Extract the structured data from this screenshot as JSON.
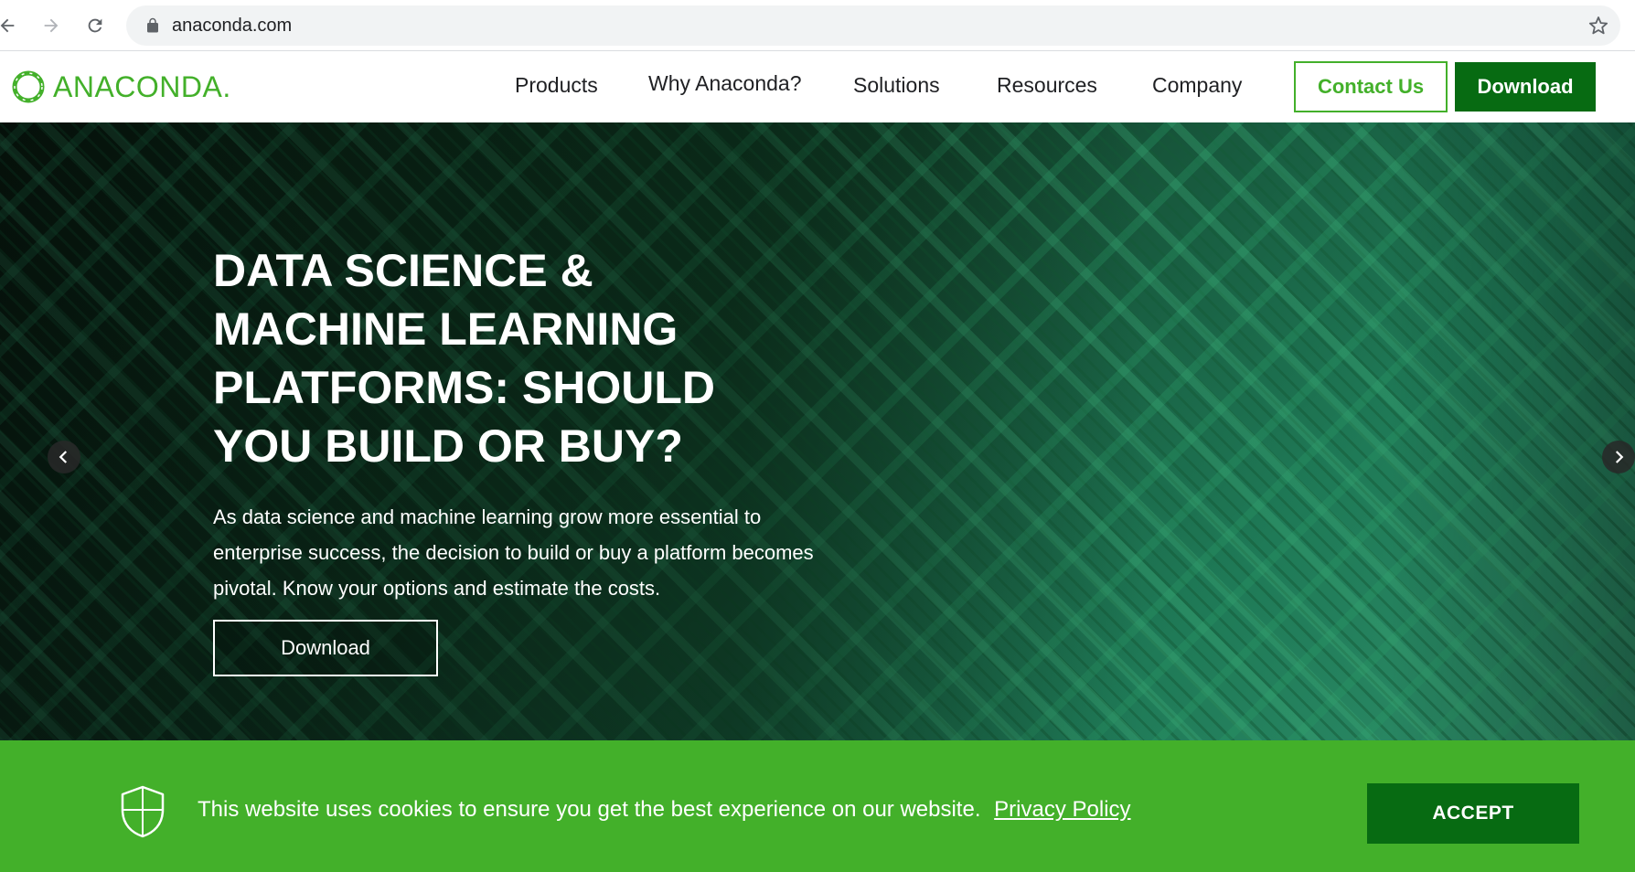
{
  "browser": {
    "url": "anaconda.com",
    "back_icon": "arrow-left-icon",
    "forward_icon": "arrow-right-icon",
    "reload_icon": "reload-icon",
    "lock_icon": "lock-icon",
    "bookmark_icon": "star-icon"
  },
  "header": {
    "logo_text": "ANACONDA.",
    "nav": [
      {
        "label": "Products"
      },
      {
        "label": "Why Anaconda?"
      },
      {
        "label": "Solutions"
      },
      {
        "label": "Resources"
      },
      {
        "label": "Company"
      }
    ],
    "contact_label": "Contact Us",
    "download_label": "Download"
  },
  "hero": {
    "title": "DATA SCIENCE & MACHINE LEARNING PLATFORMS: SHOULD YOU BUILD OR BUY?",
    "description": "As data science and machine learning grow more essential to enterprise success, the decision to build or buy a platform becomes pivotal. Know your options and estimate the costs.",
    "cta_label": "Download"
  },
  "cookie": {
    "message": "This website uses cookies to ensure you get the best experience on our website.",
    "privacy_link": "Privacy Policy",
    "accept_label": "ACCEPT"
  },
  "colors": {
    "brand_green": "#43b02a",
    "dark_green": "#076b12"
  }
}
